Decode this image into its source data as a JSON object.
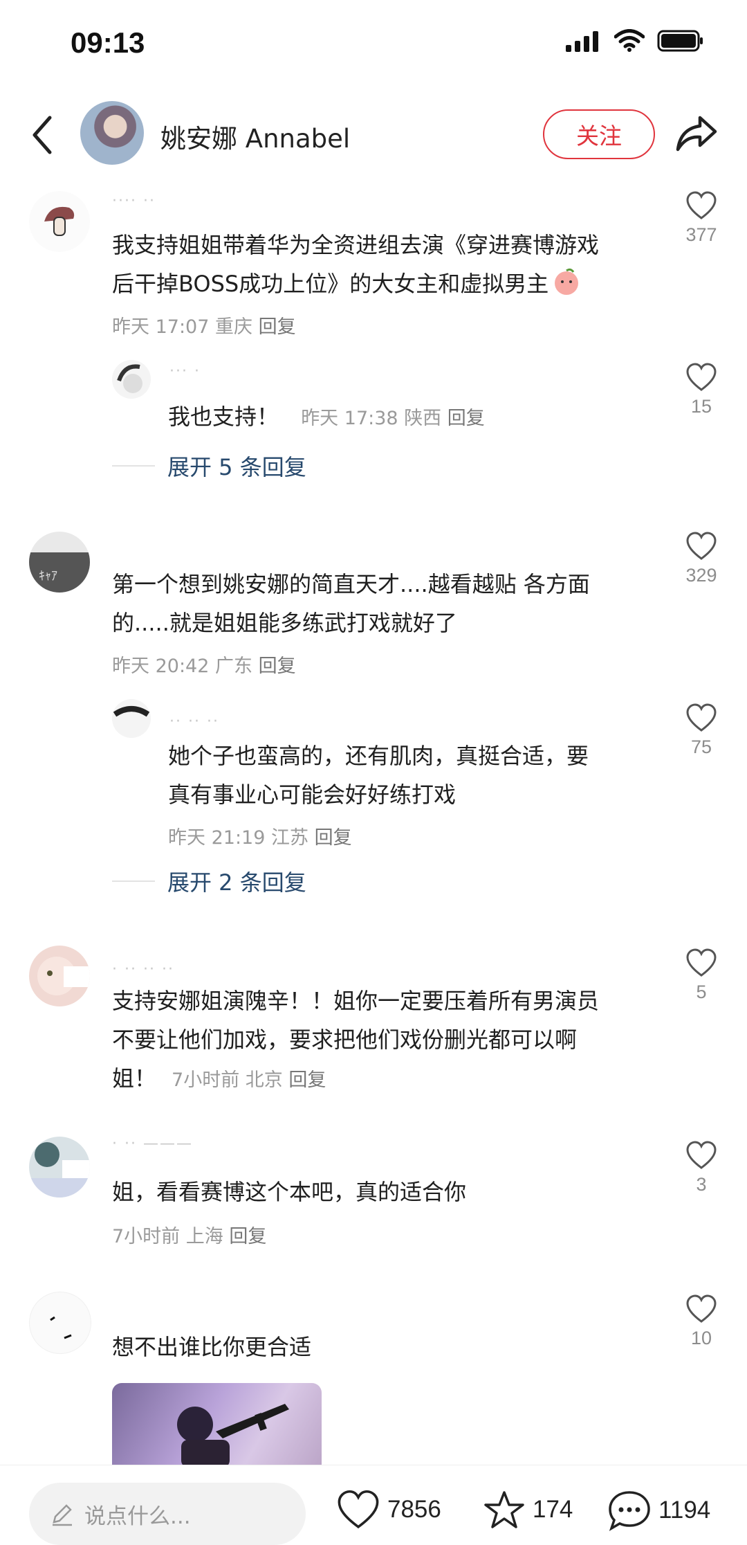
{
  "status_bar": {
    "time": "09:13"
  },
  "header": {
    "name": "姚安娜 Annabel",
    "follow_label": "关注"
  },
  "comments": [
    {
      "text_line1": "我支持姐姐带着华为全资进组去演《穿进赛博游戏",
      "text_line2": "后干掉BOSS成功上位》的大女主和虚拟男主",
      "meta_time": "昨天 17:07",
      "meta_loc": "重庆",
      "reply": "回复",
      "likes": "377",
      "subreply": {
        "text": "我也支持！",
        "meta_time": "昨天 17:38",
        "meta_loc": "陕西",
        "reply": "回复",
        "likes": "15"
      },
      "expand": "展开 5 条回复"
    },
    {
      "text_line1": "第一个想到姚安娜的简直天才....越看越贴 各方面",
      "text_line2": "的.....就是姐姐能多练武打戏就好了",
      "meta_time": "昨天 20:42",
      "meta_loc": "广东",
      "reply": "回复",
      "likes": "329",
      "subreply": {
        "text_line1": "她个子也蛮高的，还有肌肉，真挺合适，要",
        "text_line2": "真有事业心可能会好好练打戏",
        "meta_time": "昨天 21:19",
        "meta_loc": "江苏",
        "reply": "回复",
        "likes": "75"
      },
      "expand": "展开 2 条回复"
    },
    {
      "text_line1": "支持安娜姐演隗辛！！姐你一定要压着所有男演员",
      "text_line2": "不要让他们加戏，要求把他们戏份删光都可以啊",
      "text_line3": "姐！",
      "meta_time": "7小时前",
      "meta_loc": "北京",
      "reply": "回复",
      "likes": "5"
    },
    {
      "text_line1": "姐，看看赛博这个本吧，真的适合你",
      "meta_time": "7小时前",
      "meta_loc": "上海",
      "reply": "回复",
      "likes": "3"
    },
    {
      "text_line1": "想不出谁比你更合适",
      "likes": "10"
    }
  ],
  "bottom_bar": {
    "input_placeholder": "说点什么...",
    "likes": "7856",
    "stars": "174",
    "comments": "1194"
  },
  "colors": {
    "accent": "#e0343d",
    "expand_link": "#27496d",
    "meta": "#9a9a9a"
  }
}
